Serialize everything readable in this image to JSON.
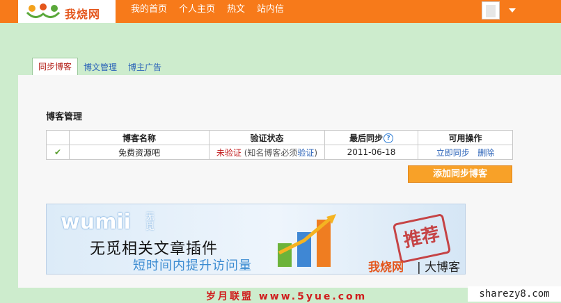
{
  "header": {
    "logo_text": "我烧网",
    "nav": [
      "我的首页",
      "个人主页",
      "热文",
      "站内信"
    ]
  },
  "tabs": [
    {
      "label": "同步博客",
      "active": true
    },
    {
      "label": "博文管理",
      "active": false
    },
    {
      "label": "博主广告",
      "active": false
    }
  ],
  "section_title": "博客管理",
  "table": {
    "headers": [
      "",
      "博客名称",
      "验证状态",
      "最后同步",
      "可用操作"
    ],
    "rows": [
      {
        "check": "✔",
        "name": "免费资源吧",
        "status_unverified": "未验证",
        "status_hint_open": " (知名博客必须",
        "status_link": "验证",
        "status_hint_close": ")",
        "last_sync": "2011-06-18",
        "action_sync": "立即同步",
        "action_delete": "删除"
      }
    ]
  },
  "help_icon": "?",
  "add_button": "添加同步博客",
  "banner": {
    "brand": "wumii",
    "brand_cn": "无觅",
    "title": "无觅相关文章插件",
    "subtitle": "短时间内提升访问量",
    "stamp": "推荐",
    "footer_brand": "我烧网",
    "footer_suffix": "| 大博客"
  },
  "watermark_footer": "岁月联盟 www.5yue.com",
  "watermark_site": "sharezy8.com",
  "colors": {
    "topbar": "#f77a1a",
    "page_bg": "#cdeccd",
    "button": "#f8a128",
    "link": "#2b63b8",
    "unverified": "#c0181a"
  }
}
